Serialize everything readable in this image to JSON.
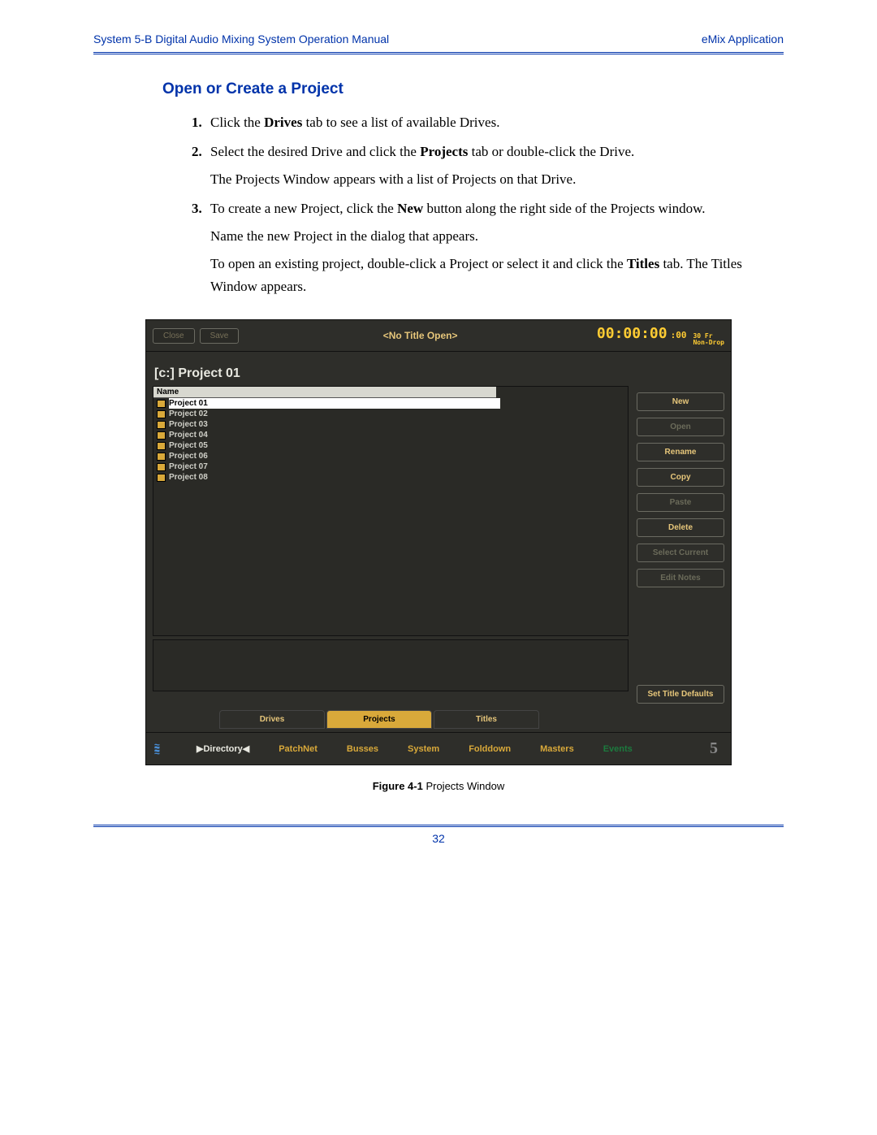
{
  "header": {
    "left": "System 5-B Digital Audio Mixing System Operation Manual",
    "right": "eMix Application"
  },
  "section_title": "Open or Create a Project",
  "steps": {
    "s1_a": "Click the ",
    "s1_bold": "Drives",
    "s1_b": " tab to see a list of available Drives.",
    "s2_a": "Select the desired Drive and click the ",
    "s2_bold": "Projects",
    "s2_b": " tab or double-click the Drive.",
    "s2_sub": "The Projects Window appears with a list of Projects on that Drive.",
    "s3_a": "To create a new Project, click the ",
    "s3_bold": "New",
    "s3_b": " button along the right side of the Projects window.",
    "s3_sub1": "Name the new Project in the dialog that appears.",
    "s3_sub2_a": "To open an existing project, double-click a Project or select it and click the ",
    "s3_sub2_bold": "Titles",
    "s3_sub2_b": " tab. The Titles Window appears."
  },
  "shot": {
    "top_buttons": {
      "close": "Close",
      "save": "Save"
    },
    "top_title": "<No Title Open>",
    "timecode": {
      "main": "00:00:00",
      "sub": ":00",
      "meta1": "30 Fr",
      "meta2": "Non-Drop"
    },
    "path": "[c:] Project 01",
    "list_header": "Name",
    "projects": [
      "Project 01",
      "Project 02",
      "Project 03",
      "Project 04",
      "Project 05",
      "Project 06",
      "Project 07",
      "Project 08"
    ],
    "right_buttons": [
      {
        "label": "New",
        "disabled": false
      },
      {
        "label": "Open",
        "disabled": true
      },
      {
        "label": "Rename",
        "disabled": false
      },
      {
        "label": "Copy",
        "disabled": false
      },
      {
        "label": "Paste",
        "disabled": true
      },
      {
        "label": "Delete",
        "disabled": false
      },
      {
        "label": "Select Current",
        "disabled": true
      },
      {
        "label": "Edit Notes",
        "disabled": true
      }
    ],
    "set_defaults": "Set Title Defaults",
    "tabs": [
      "Drives",
      "Projects",
      "Titles"
    ],
    "tab_active": 1,
    "bottom_nav": {
      "directory": "▶Directory◀",
      "items": [
        "PatchNet",
        "Busses",
        "System",
        "Folddown",
        "Masters"
      ],
      "events": "Events",
      "cursive": "5"
    }
  },
  "caption": {
    "bold": "Figure 4-1",
    "rest": " Projects Window"
  },
  "page_number": "32"
}
